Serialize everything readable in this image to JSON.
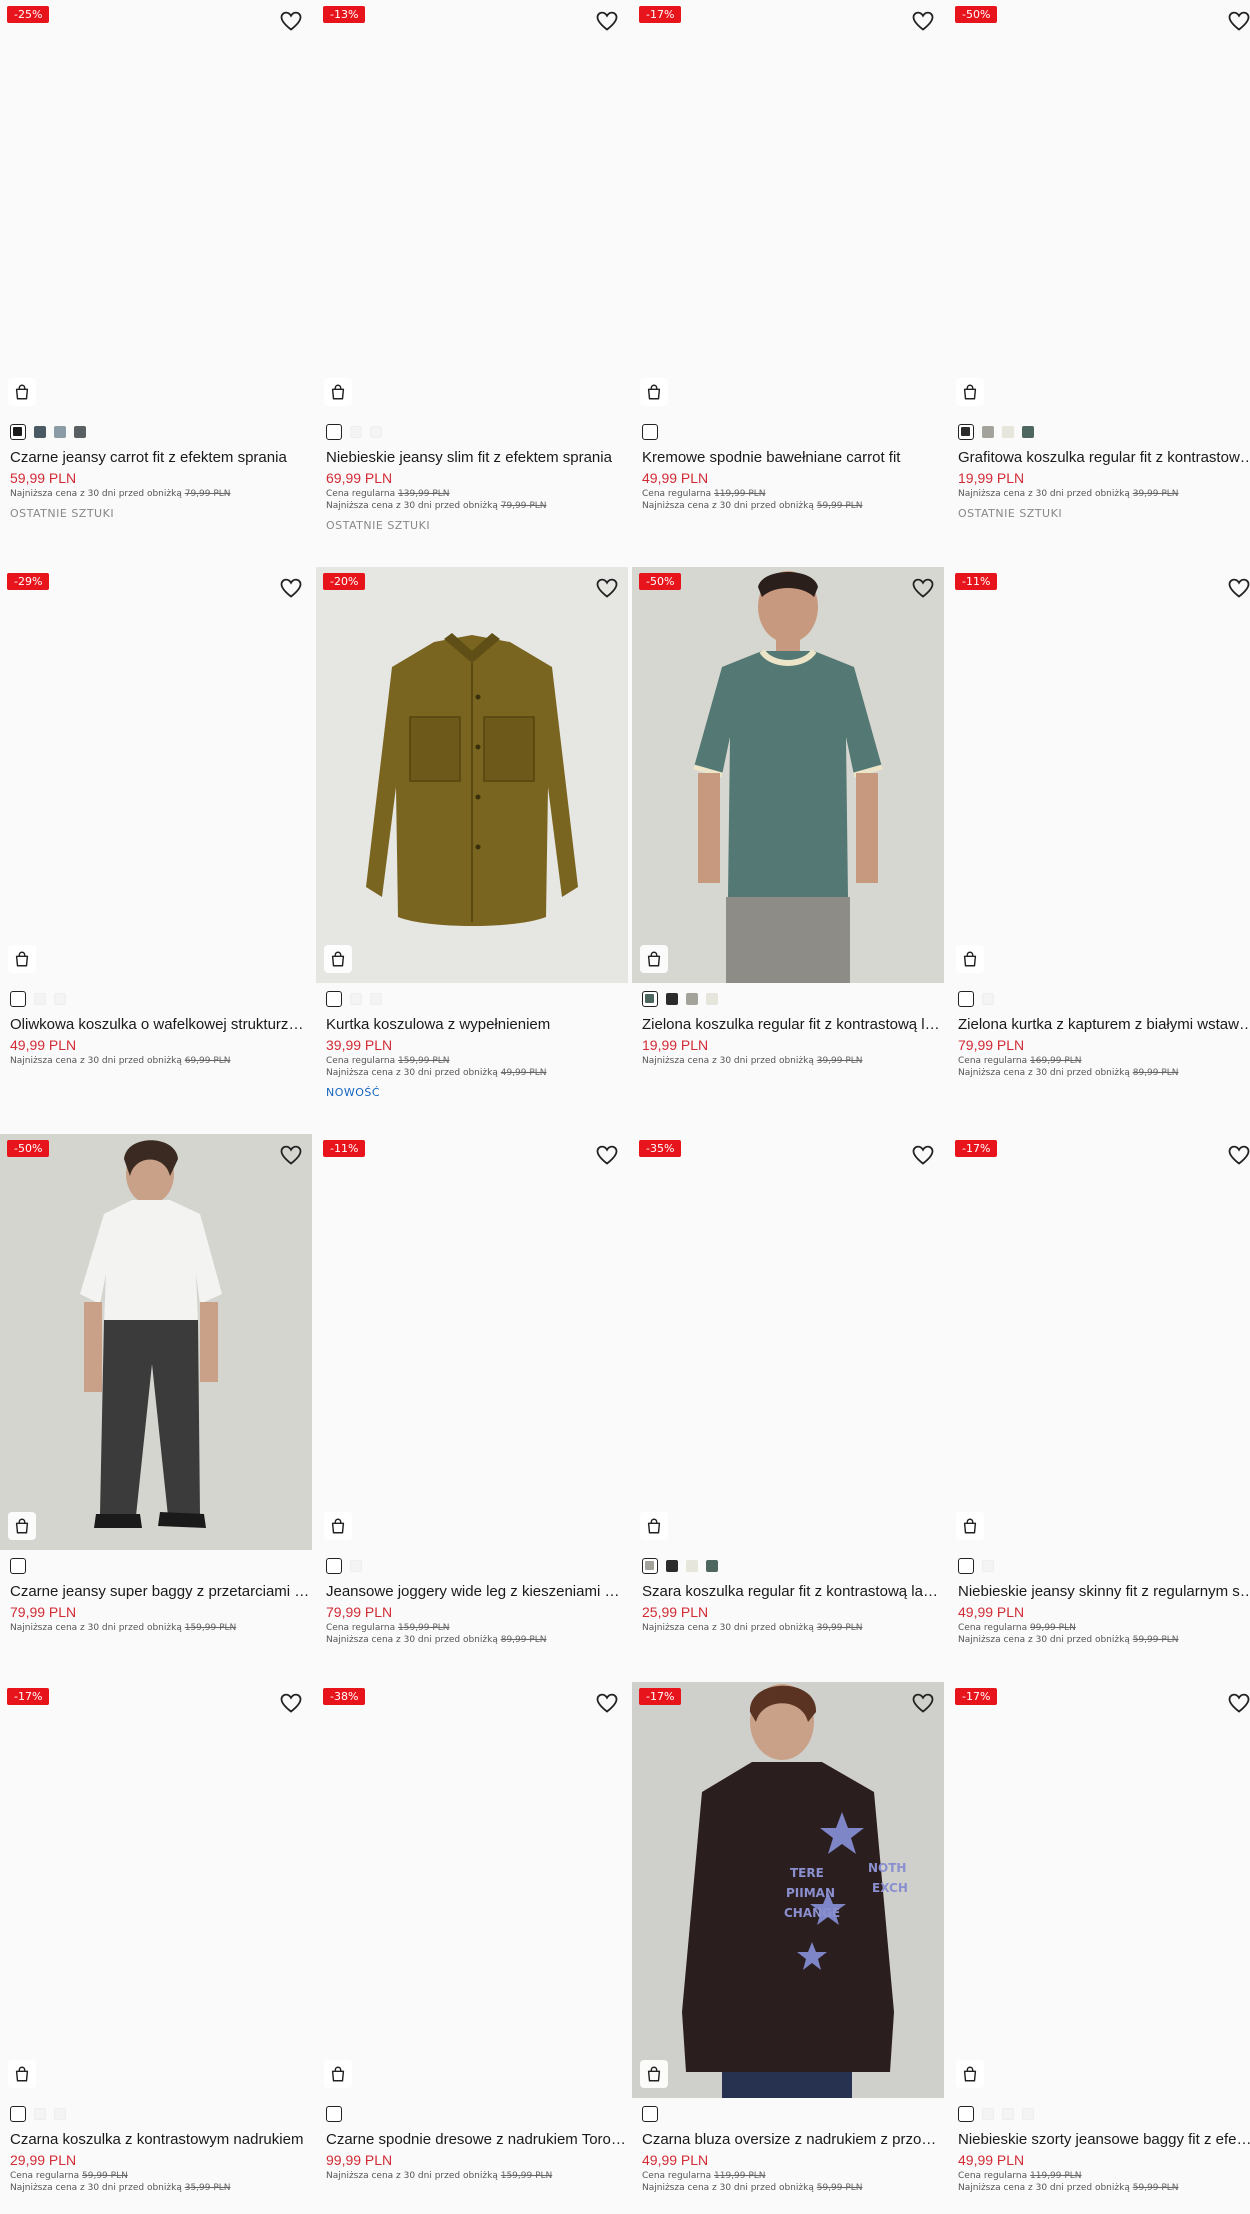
{
  "products": [
    {
      "discount": "-25%",
      "title": "Czarne jeansy carrot fit z efektem sprania",
      "price": "59,99 PLN",
      "regular": null,
      "lowest_label": "Najniższa cena z 30 dni przed obniżką",
      "lowest_price": "79,99 PLN",
      "tag": "OSTATNIE SZTUKI",
      "tag_style": "last",
      "swatches": [
        "#1a1a1a",
        "#4a5a63",
        "#8a9ba6",
        "#5a5f62"
      ]
    },
    {
      "discount": "-13%",
      "title": "Niebieskie jeansy slim fit z efektem sprania",
      "price": "69,99 PLN",
      "regular_label": "Cena regularna",
      "regular": "139,99 PLN",
      "lowest_label": "Najniższa cena z 30 dni przed obniżką",
      "lowest_price": "79,99 PLN",
      "tag": "OSTATNIE SZTUKI",
      "tag_style": "last",
      "swatches": [
        "#ffffff",
        "#f4f4f4",
        "#f4f4f4"
      ]
    },
    {
      "discount": "-17%",
      "title": "Kremowe spodnie bawełniane carrot fit",
      "price": "49,99 PLN",
      "regular_label": "Cena regularna",
      "regular": "119,99 PLN",
      "lowest_label": "Najniższa cena z 30 dni przed obniżką",
      "lowest_price": "59,99 PLN",
      "tag": "",
      "swatches": [
        "#ffffff"
      ]
    },
    {
      "discount": "-50%",
      "title": "Grafitowa koszulka regular fit z kontrastową lamówką",
      "price": "19,99 PLN",
      "regular": null,
      "lowest_label": "Najniższa cena z 30 dni przed obniżką",
      "lowest_price": "39,99 PLN",
      "tag": "OSTATNIE SZTUKI",
      "tag_style": "last",
      "swatches": [
        "#2b2b2b",
        "#a3a39c",
        "#e6e6dc",
        "#4e6660"
      ]
    },
    {
      "discount": "-29%",
      "title": "Oliwkowa koszulka o wafelkowej strukturze z kontrastem",
      "price": "49,99 PLN",
      "regular": null,
      "lowest_label": "Najniższa cena z 30 dni przed obniżką",
      "lowest_price": "69,99 PLN",
      "tag": "",
      "swatches": [
        "#ffffff",
        "#f4f4f4",
        "#f4f4f4"
      ]
    },
    {
      "discount": "-20%",
      "title": "Kurtka koszulowa z wypełnieniem",
      "price": "39,99 PLN",
      "regular_label": "Cena regularna",
      "regular": "159,99 PLN",
      "lowest_label": "Najniższa cena z 30 dni przed obniżką",
      "lowest_price": "49,99 PLN",
      "tag": "NOWOŚĆ",
      "tag_style": "new",
      "swatches": [
        "#ffffff",
        "#f4f4f4",
        "#f4f4f4"
      ],
      "photo": "jacket"
    },
    {
      "discount": "-50%",
      "title": "Zielona koszulka regular fit z kontrastową lamówką",
      "price": "19,99 PLN",
      "regular": null,
      "lowest_label": "Najniższa cena z 30 dni przed obniżką",
      "lowest_price": "39,99 PLN",
      "tag": "",
      "swatches": [
        "#4e6660",
        "#2b2b2b",
        "#a3a39c",
        "#e6e6dc"
      ],
      "photo": "tshirt"
    },
    {
      "discount": "-11%",
      "title": "Zielona kurtka z kapturem z białymi wstawkami",
      "price": "79,99 PLN",
      "regular_label": "Cena regularna",
      "regular": "169,99 PLN",
      "lowest_label": "Najniższa cena z 30 dni przed obniżką",
      "lowest_price": "89,99 PLN",
      "tag": "",
      "swatches": [
        "#ffffff",
        "#f4f4f4"
      ]
    },
    {
      "discount": "-50%",
      "title": "Czarne jeansy super baggy z przetarciami na kolanach",
      "price": "79,99 PLN",
      "regular": null,
      "lowest_label": "Najniższa cena z 30 dni przed obniżką",
      "lowest_price": "159,99 PLN",
      "tag": "",
      "swatches": [
        "#ffffff"
      ],
      "photo": "baggy"
    },
    {
      "discount": "-11%",
      "title": "Jeansowe joggery wide leg z kieszeniami cargo",
      "price": "79,99 PLN",
      "regular_label": "Cena regularna",
      "regular": "159,99 PLN",
      "lowest_label": "Najniższa cena z 30 dni przed obniżką",
      "lowest_price": "89,99 PLN",
      "tag": "",
      "swatches": [
        "#ffffff",
        "#f4f4f4"
      ]
    },
    {
      "discount": "-35%",
      "title": "Szara koszulka regular fit z kontrastową lamówką",
      "price": "25,99 PLN",
      "regular": null,
      "lowest_label": "Najniższa cena z 30 dni przed obniżką",
      "lowest_price": "39,99 PLN",
      "tag": "",
      "swatches": [
        "#a3a39c",
        "#2b2b2b",
        "#e6e6dc",
        "#4e6660"
      ]
    },
    {
      "discount": "-17%",
      "title": "Niebieskie jeansy skinny fit z regularnym stanem",
      "price": "49,99 PLN",
      "regular_label": "Cena regularna",
      "regular": "99,99 PLN",
      "lowest_label": "Najniższa cena z 30 dni przed obniżką",
      "lowest_price": "59,99 PLN",
      "tag": "",
      "swatches": [
        "#ffffff",
        "#f4f4f4"
      ]
    },
    {
      "discount": "-17%",
      "title": "Czarna koszulka z kontrastowym nadrukiem",
      "price": "29,99 PLN",
      "regular_label": "Cena regularna",
      "regular": "59,99 PLN",
      "lowest_label": "Najniższa cena z 30 dni przed obniżką",
      "lowest_price": "35,99 PLN",
      "tag": "",
      "swatches": [
        "#ffffff",
        "#f4f4f4",
        "#f4f4f4"
      ]
    },
    {
      "discount": "-38%",
      "title": "Czarne spodnie dresowe z nadrukiem Toronto",
      "price": "99,99 PLN",
      "regular": null,
      "lowest_label": "Najniższa cena z 30 dni przed obniżką",
      "lowest_price": "159,99 PLN",
      "tag": "",
      "swatches": [
        "#ffffff"
      ]
    },
    {
      "discount": "-17%",
      "title": "Czarna bluza oversize z nadrukiem z przodu i z tyłu",
      "price": "49,99 PLN",
      "regular_label": "Cena regularna",
      "regular": "119,99 PLN",
      "lowest_label": "Najniższa cena z 30 dni przed obniżką",
      "lowest_price": "59,99 PLN",
      "tag": "",
      "swatches": [
        "#ffffff"
      ],
      "photo": "hoodie",
      "print_lines": [
        "TERE",
        "PIIMAN",
        "CHANGE",
        "NOTH",
        "EXCH"
      ]
    },
    {
      "discount": "-17%",
      "title": "Niebieskie szorty jeansowe baggy fit z efektem sprania",
      "price": "49,99 PLN",
      "regular_label": "Cena regularna",
      "regular": "119,99 PLN",
      "lowest_label": "Najniższa cena z 30 dni przed obniżką",
      "lowest_price": "59,99 PLN",
      "tag": "",
      "swatches": [
        "#ffffff",
        "#f4f4f4",
        "#f4f4f4",
        "#f4f4f4"
      ]
    }
  ],
  "colors": {
    "discount_bg": "#e8141c",
    "price": "#d22b35",
    "new_tag": "#1565c0"
  },
  "icons": {
    "wishlist": "heart-icon",
    "cart": "shopping-bag-icon"
  }
}
